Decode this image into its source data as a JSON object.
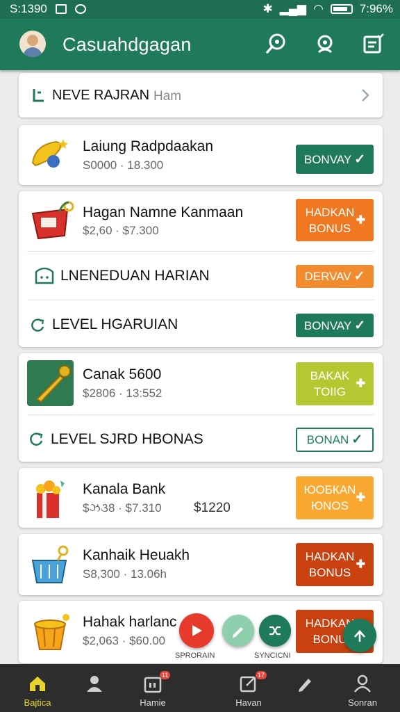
{
  "status_bar": {
    "time_left": "S:1390",
    "time_right": "7:96%"
  },
  "app_bar": {
    "title": "Casuahdgagan"
  },
  "level_header": {
    "title": "NEVE RAJRAN",
    "suffix": "Ham"
  },
  "items": [
    {
      "title": "Laiung Radpdaakan",
      "detail": "S0000 · 18.300",
      "button": "BONVAY",
      "button_color": "#1f7a5a",
      "button_icon": "check-icon"
    },
    {
      "title": "Hagan Namne Kanmaan",
      "detail": "$2,60 · $7.300",
      "button": "HADKAN BONUS",
      "button_color": "#f07820",
      "button_icon": "plus-icon"
    },
    {
      "title": "LNENEDUAN HARIAN",
      "button": "DERVAV",
      "button_color": "#f28a2e",
      "button_icon": "check-icon"
    },
    {
      "title": "LEVEL HGARUIAN",
      "button": "BONVAY",
      "button_color": "#1f7a5a",
      "button_icon": "check-icon"
    },
    {
      "title": "Canak 5600",
      "detail": "$2806 · 13:552",
      "button": "BAKAK TOIIG",
      "button_color": "#b5c832",
      "button_icon": "plus-icon"
    },
    {
      "title": "LEVEL SJRD HBONAS",
      "button": "BONAN",
      "button_color": "#ffffff",
      "button_text_color": "#1f7a5a",
      "button_icon": "check-icon"
    },
    {
      "title": "Kanala Bank",
      "detail": "$ઝ૩8 · $7.310",
      "extra": "$1220",
      "button": "ЮОБКАN ЮNOS",
      "button_color": "#f9a832",
      "button_icon": "plus-icon"
    },
    {
      "title": "Kanhaik Heuakh",
      "detail": "S8,300 · 13.06h",
      "button": "HADKAN BONUS",
      "button_color": "#c8410f",
      "button_icon": "plus-icon"
    },
    {
      "title": "Hahak harlanc",
      "detail": "$2,063 · $60.00",
      "button": "HADKAN BONU",
      "button_color": "#c8410f",
      "button_icon": "plus-icon"
    }
  ],
  "fabs": {
    "play_caption": "SPRORAIN",
    "right_caption": "SYNCICNI"
  },
  "bottom_nav": [
    {
      "label": "Bajtica",
      "icon": "home-icon",
      "active": true
    },
    {
      "label": "",
      "icon": "person-icon"
    },
    {
      "label": "Hamie",
      "icon": "gift-box-icon",
      "badge": "11"
    },
    {
      "label": "Havan",
      "icon": "edit-icon",
      "badge": "17"
    },
    {
      "label": "",
      "icon": "pencil-icon"
    },
    {
      "label": "Sonran",
      "icon": "profile-icon"
    }
  ],
  "colors": {
    "primary": "#1f7a5a",
    "orange": "#f07820",
    "red": "#c8410f",
    "lime": "#b5c832",
    "amber": "#f9a832",
    "fab_red": "#e53a2c"
  }
}
